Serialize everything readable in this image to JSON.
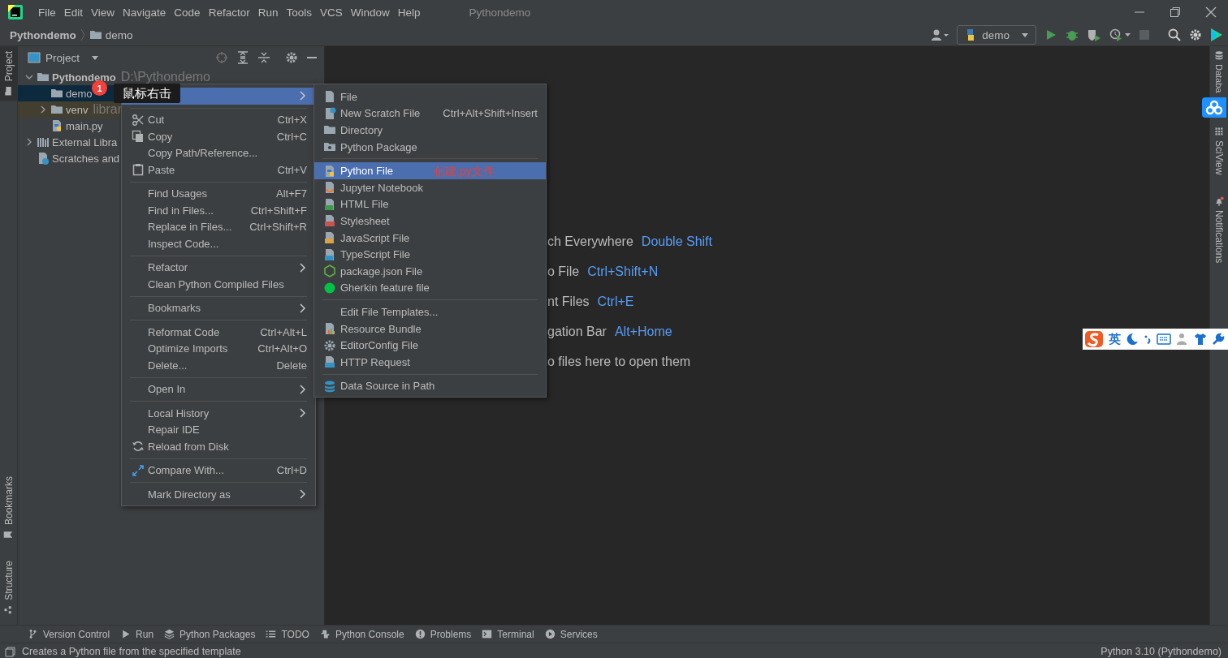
{
  "title_bar": {
    "menu": [
      "File",
      "Edit",
      "View",
      "Navigate",
      "Code",
      "Refactor",
      "Run",
      "Tools",
      "VCS",
      "Window",
      "Help"
    ],
    "title": "Pythondemo"
  },
  "nav_bar": {
    "breadcrumb": [
      "Pythondemo",
      "demo"
    ],
    "run_config": "demo"
  },
  "left_stripe": {
    "top": [
      {
        "label": "Project",
        "selected": true
      }
    ],
    "bottom": [
      {
        "label": "Bookmarks",
        "selected": false
      },
      {
        "label": "Structure",
        "selected": false
      }
    ]
  },
  "right_stripe": [
    {
      "label": "Databa",
      "kind": "database"
    },
    {
      "label": "SciView",
      "kind": "sciview"
    },
    {
      "label": "Notifications",
      "kind": "notifications"
    }
  ],
  "project": {
    "title": "Project",
    "tree": [
      {
        "label": "Pythondemo",
        "hint": "D:\\Pythondemo",
        "kind": "folder",
        "expanded": true,
        "selected": false,
        "children": [
          {
            "label": "demo",
            "kind": "folder",
            "selected": true
          },
          {
            "label": "venv",
            "hint": "librar",
            "kind": "library",
            "expanded": false,
            "selected": false
          },
          {
            "label": "main.py",
            "kind": "python",
            "selected": false
          }
        ]
      },
      {
        "label": "External Libra",
        "kind": "libraries",
        "expanded": false,
        "selected": false
      },
      {
        "label": "Scratches and",
        "kind": "scratches",
        "selected": false
      }
    ]
  },
  "editor": {
    "hints": [
      {
        "text": "ch Everywhere",
        "shortcut": "Double Shift"
      },
      {
        "text": "o File",
        "shortcut": "Ctrl+Shift+N"
      },
      {
        "text": "nt Files",
        "shortcut": "Ctrl+E"
      },
      {
        "text": "gation Bar",
        "shortcut": "Alt+Home"
      },
      {
        "text": "o files here to open them"
      }
    ]
  },
  "context_menu": {
    "items": [
      {
        "kind": "plain",
        "submenu": true,
        "selected": true
      },
      {
        "kind": "separator"
      },
      {
        "kind": "cut",
        "label": "Cut",
        "shortcut": "Ctrl+X",
        "selected": false
      },
      {
        "kind": "copy",
        "label": "Copy",
        "shortcut": "Ctrl+C",
        "selected": false
      },
      {
        "kind": "plain",
        "label": "Copy Path/Reference...",
        "selected": false
      },
      {
        "kind": "paste",
        "label": "Paste",
        "shortcut": "Ctrl+V",
        "selected": false
      },
      {
        "kind": "separator"
      },
      {
        "kind": "plain",
        "label": "Find Usages",
        "shortcut": "Alt+F7",
        "selected": false
      },
      {
        "kind": "plain",
        "label": "Find in Files...",
        "shortcut": "Ctrl+Shift+F",
        "selected": false
      },
      {
        "kind": "plain",
        "label": "Replace in Files...",
        "shortcut": "Ctrl+Shift+R",
        "selected": false
      },
      {
        "kind": "plain",
        "label": "Inspect Code...",
        "selected": false
      },
      {
        "kind": "separator"
      },
      {
        "kind": "plain",
        "label": "Refactor",
        "submenu": true,
        "selected": false
      },
      {
        "kind": "plain",
        "label": "Clean Python Compiled Files",
        "selected": false
      },
      {
        "kind": "separator"
      },
      {
        "kind": "plain",
        "label": "Bookmarks",
        "submenu": true,
        "selected": false
      },
      {
        "kind": "separator"
      },
      {
        "kind": "plain",
        "label": "Reformat Code",
        "shortcut": "Ctrl+Alt+L",
        "selected": false
      },
      {
        "kind": "plain",
        "label": "Optimize Imports",
        "shortcut": "Ctrl+Alt+O",
        "selected": false
      },
      {
        "kind": "plain",
        "label": "Delete...",
        "shortcut": "Delete",
        "selected": false
      },
      {
        "kind": "separator"
      },
      {
        "kind": "plain",
        "label": "Open In",
        "submenu": true,
        "selected": false
      },
      {
        "kind": "separator"
      },
      {
        "kind": "plain",
        "label": "Local History",
        "submenu": true,
        "selected": false
      },
      {
        "kind": "plain",
        "label": "Repair IDE",
        "selected": false
      },
      {
        "kind": "reload",
        "label": "Reload from Disk",
        "selected": false
      },
      {
        "kind": "separator"
      },
      {
        "kind": "compare",
        "label": "Compare With...",
        "shortcut": "Ctrl+D",
        "selected": false
      },
      {
        "kind": "separator"
      },
      {
        "kind": "plain",
        "label": "Mark Directory as",
        "submenu": true,
        "selected": false
      }
    ]
  },
  "new_submenu": {
    "items": [
      {
        "kind": "file",
        "label": "File",
        "selected": false
      },
      {
        "kind": "scratch",
        "label": "New Scratch File",
        "shortcut": "Ctrl+Alt+Shift+Insert",
        "selected": false
      },
      {
        "kind": "directory",
        "label": "Directory",
        "selected": false
      },
      {
        "kind": "package",
        "label": "Python Package",
        "selected": false
      },
      {
        "kind": "separator"
      },
      {
        "kind": "python",
        "label": "Python File",
        "selected": true
      },
      {
        "kind": "jupyter",
        "label": "Jupyter Notebook",
        "selected": false
      },
      {
        "kind": "html",
        "label": "HTML File",
        "selected": false
      },
      {
        "kind": "css",
        "label": "Stylesheet",
        "selected": false
      },
      {
        "kind": "js",
        "label": "JavaScript File",
        "selected": false
      },
      {
        "kind": "ts",
        "label": "TypeScript File",
        "selected": false
      },
      {
        "kind": "npm",
        "label": "package.json File",
        "selected": false
      },
      {
        "kind": "gherkin",
        "label": "Gherkin feature file",
        "selected": false
      },
      {
        "kind": "separator"
      },
      {
        "kind": "plain",
        "label": "Edit File Templates...",
        "selected": false
      },
      {
        "kind": "bundle",
        "label": "Resource Bundle",
        "selected": false
      },
      {
        "kind": "config",
        "label": "EditorConfig File",
        "selected": false
      },
      {
        "kind": "http",
        "label": "HTTP Request",
        "selected": false
      },
      {
        "kind": "separator"
      },
      {
        "kind": "datasource",
        "label": "Data Source in Path",
        "selected": false
      }
    ]
  },
  "annotations": {
    "step": "1",
    "right_click_note": "鼠标右击",
    "python_file_note": "创建.py文件"
  },
  "ime_toolbar": {
    "mode": "英"
  },
  "tool_windows": [
    {
      "label": "Version Control",
      "kind": "vcs"
    },
    {
      "label": "Run",
      "kind": "run"
    },
    {
      "label": "Python Packages",
      "kind": "packages"
    },
    {
      "label": "TODO",
      "kind": "todo"
    },
    {
      "label": "Python Console",
      "kind": "console"
    },
    {
      "label": "Problems",
      "kind": "problems"
    },
    {
      "label": "Terminal",
      "kind": "terminal"
    },
    {
      "label": "Services",
      "kind": "services"
    }
  ],
  "status_bar": {
    "message": "Creates a Python file from the specified template",
    "interpreter": "Python 3.10 (Pythondemo)"
  }
}
